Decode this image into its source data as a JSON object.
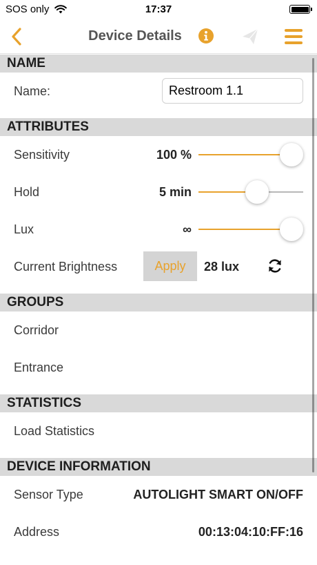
{
  "status_bar": {
    "carrier": "SOS only",
    "time": "17:37"
  },
  "nav": {
    "title": "Device Details"
  },
  "icons": {
    "back": "chevron-left-icon",
    "info": "info-icon",
    "send": "paper-plane-icon",
    "menu": "hamburger-menu-icon",
    "refresh": "refresh-icon"
  },
  "colors": {
    "accent": "#e8a22c",
    "section_header_bg": "#d9d9d9",
    "slider_track": "#b8b8b8"
  },
  "sections": {
    "name": {
      "header": "NAME",
      "label": "Name:",
      "value": "Restroom 1.1"
    },
    "attributes": {
      "header": "ATTRIBUTES",
      "sensitivity": {
        "label": "Sensitivity",
        "value": "100 %",
        "level": 1.0
      },
      "hold": {
        "label": "Hold",
        "value": "5 min",
        "level": 0.56
      },
      "lux": {
        "label": "Lux",
        "value": "∞",
        "level": 1.0
      },
      "brightness": {
        "label": "Current Brightness",
        "apply": "Apply",
        "value": "28 lux"
      }
    },
    "groups": {
      "header": "GROUPS",
      "items": [
        "Corridor",
        "Entrance"
      ]
    },
    "statistics": {
      "header": "STATISTICS",
      "load": "Load Statistics"
    },
    "device_information": {
      "header": "DEVICE INFORMATION",
      "sensor_type": {
        "label": "Sensor Type",
        "value": "AUTOLIGHT SMART ON/OFF"
      },
      "address": {
        "label": "Address",
        "value": "00:13:04:10:FF:16"
      }
    }
  }
}
